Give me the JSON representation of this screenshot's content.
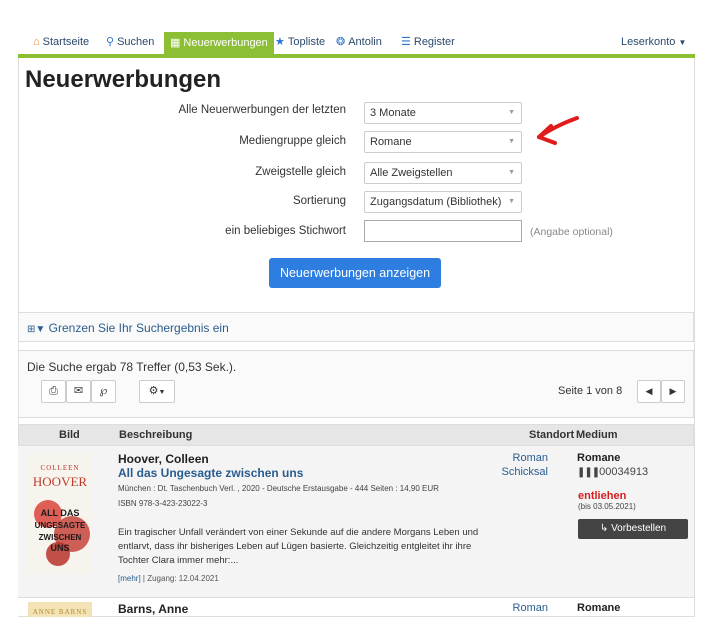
{
  "nav": {
    "home": "Startseite",
    "search": "Suchen",
    "new": "Neuerwerbungen",
    "toplist": "Topliste",
    "antolin": "Antolin",
    "register": "Register",
    "account": "Leserkonto"
  },
  "page": {
    "title": "Neuerwerbungen"
  },
  "form": {
    "period_label": "Alle Neuerwerbungen der letzten",
    "period_value": "3 Monate",
    "media_label": "Mediengruppe gleich",
    "media_value": "Romane",
    "branch_label": "Zweigstelle gleich",
    "branch_value": "Alle Zweigstellen",
    "sort_label": "Sortierung",
    "sort_value": "Zugangsdatum (Bibliothek)",
    "keyword_label": "ein beliebiges Stichwort",
    "keyword_value": "",
    "optional_hint": "(Angabe optional)",
    "submit_label": "Neuerwerbungen anzeigen"
  },
  "filter": {
    "label": "Grenzen Sie Ihr Suchergebnis ein"
  },
  "results": {
    "summary": "Die Suche ergab 78 Treffer (0,53 Sek.).",
    "page_info": "Seite 1 von 8"
  },
  "table": {
    "col_image": "Bild",
    "col_desc": "Beschreibung",
    "col_location": "Standort",
    "col_medium": "Medium"
  },
  "items": [
    {
      "author": "Hoover, Colleen",
      "title": "All das Ungesagte zwischen uns",
      "publication": "München : Dt. Taschenbuch Verl. , 2020 - Deutsche Erstausgabe - 444 Seiten : 14,90 EUR",
      "isbn": "ISBN 978-3-423-23022-3",
      "description": "Ein tragischer Unfall verändert von einer Sekunde auf die andere Morgans Leben und entlarvt, dass ihr bisheriges Leben auf Lügen basierte. Gleichzeitig entgleitet ihr ihre Tochter Clara immer mehr:...",
      "more": "[mehr]",
      "access": "| Zugang: 12.04.2021",
      "location_1": "Roman",
      "location_2": "Schicksal",
      "medium": "Romane",
      "barcode": "00034913",
      "status": "entliehen",
      "until": "(bis 03.05.2021)",
      "reserve": "Vorbestellen",
      "cover_top": "COLLEEN",
      "cover_name": "HOOVER",
      "cover_title": "ALL DAS UNGESAGTE ZWISCHEN UNS"
    },
    {
      "author": "Barns, Anne",
      "location_1": "Roman",
      "medium": "Romane",
      "cover_name": "ANNE BARNS"
    }
  ],
  "colors": {
    "accent": "#8cbf34",
    "primary": "#2e7de1",
    "link": "#2a5d8f",
    "status": "#d41f1f"
  }
}
